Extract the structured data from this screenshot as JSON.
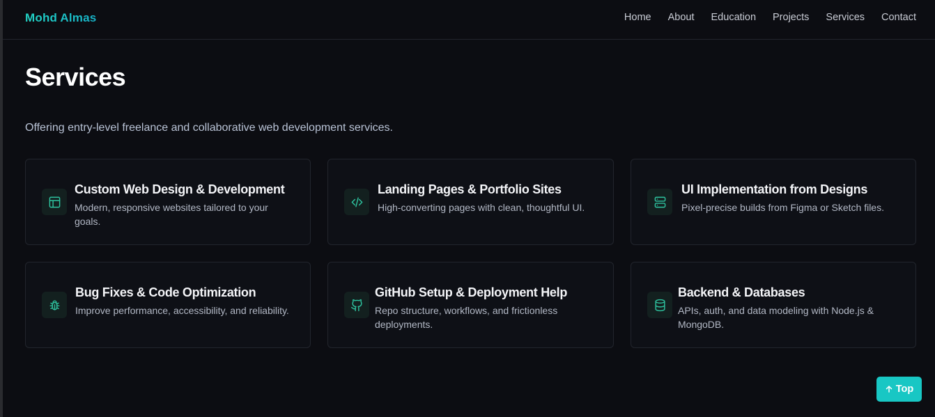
{
  "brand": {
    "name": "Mohd Almas"
  },
  "nav": [
    "Home",
    "About",
    "Education",
    "Projects",
    "Services",
    "Contact"
  ],
  "page": {
    "title": "Services",
    "subtitle": "Offering entry-level freelance and collaborative web development services."
  },
  "services": [
    {
      "icon": "layout-icon",
      "title": "Custom Web Design & Development",
      "description": "Modern, responsive websites tailored to your goals."
    },
    {
      "icon": "code-icon",
      "title": "Landing Pages & Portfolio Sites",
      "description": "High-converting pages with clean, thoughtful UI."
    },
    {
      "icon": "server-icon",
      "title": "UI Implementation from Designs",
      "description": "Pixel-precise builds from Figma or Sketch files."
    },
    {
      "icon": "bug-icon",
      "title": "Bug Fixes & Code Optimization",
      "description": "Improve performance, accessibility, and reliability."
    },
    {
      "icon": "github-icon",
      "title": "GitHub Setup & Deployment Help",
      "description": "Repo structure, workflows, and frictionless deployments."
    },
    {
      "icon": "database-icon",
      "title": "Backend & Databases",
      "description": "APIs, auth, and data modeling with Node.js & MongoDB."
    }
  ],
  "back_to_top": {
    "label": "Top",
    "icon": "arrow-up-icon"
  },
  "colors": {
    "background": "#0c0d12",
    "accent": "#18c7c4",
    "icon_green": "#2ec4a0",
    "card_border": "#22252d"
  }
}
